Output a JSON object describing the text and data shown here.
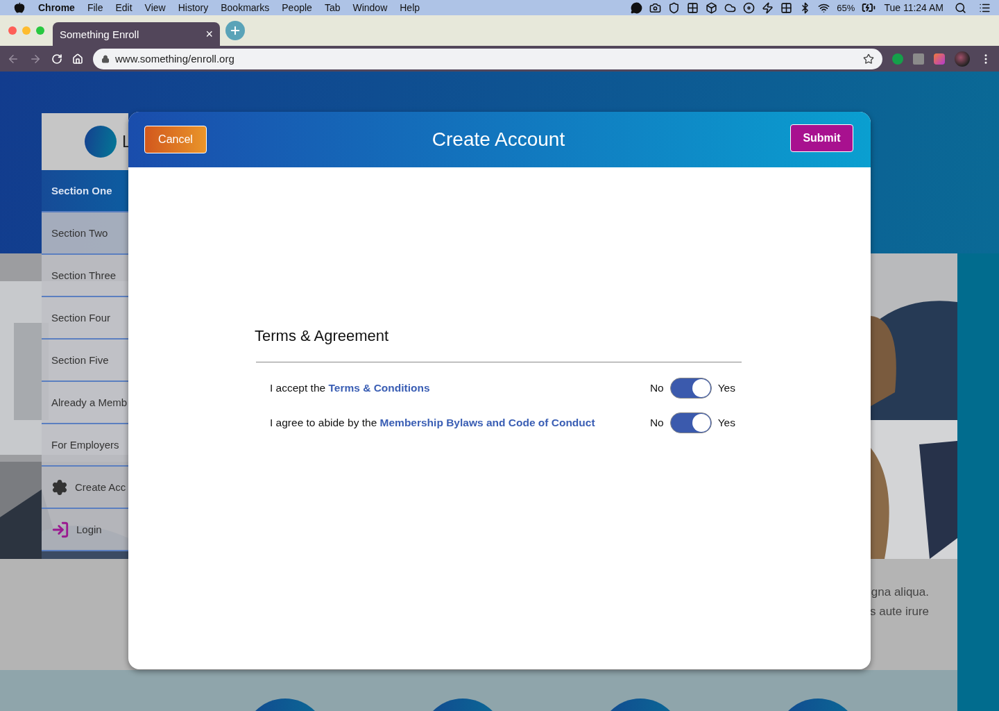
{
  "menubar": {
    "app": "Chrome",
    "menus": [
      "File",
      "Edit",
      "View",
      "History",
      "Bookmarks",
      "People",
      "Tab",
      "Window",
      "Help"
    ],
    "battery": "65%",
    "clock": "Tue 11:24 AM"
  },
  "browser": {
    "tab": {
      "title": "Something Enroll",
      "close": "×"
    },
    "url": "www.something/enroll.org"
  },
  "sidebar": {
    "logo_text": "L",
    "items": [
      {
        "label": "Section One",
        "kind": "plain",
        "selected": true
      },
      {
        "label": "Section Two",
        "kind": "plain",
        "selected": false
      },
      {
        "label": "Section Three",
        "kind": "plain",
        "selected": false
      },
      {
        "label": "Section Four",
        "kind": "plain",
        "selected": false
      },
      {
        "label": "Section Five",
        "kind": "plain",
        "selected": false
      },
      {
        "label": "Already a Memb",
        "kind": "plain",
        "selected": false
      },
      {
        "label": "For Employers",
        "kind": "plain",
        "selected": false
      },
      {
        "label": "Create Acc",
        "kind": "settings",
        "selected": false
      },
      {
        "label": "Login",
        "kind": "login",
        "selected": false
      }
    ]
  },
  "page_text": [
    "gna aliqua.",
    "s aute irure"
  ],
  "modal": {
    "title": "Create Account",
    "cancel": "Cancel",
    "submit": "Submit",
    "section_title": "Terms & Agreement",
    "agreements": [
      {
        "text": "I accept the ",
        "link": "Terms & Conditions",
        "off_label": "No",
        "on_label": "Yes",
        "on": true
      },
      {
        "text": "I agree to abide by the ",
        "link": "Membership Bylaws and Code of Conduct",
        "off_label": "No",
        "on_label": "Yes",
        "on": true
      }
    ]
  }
}
